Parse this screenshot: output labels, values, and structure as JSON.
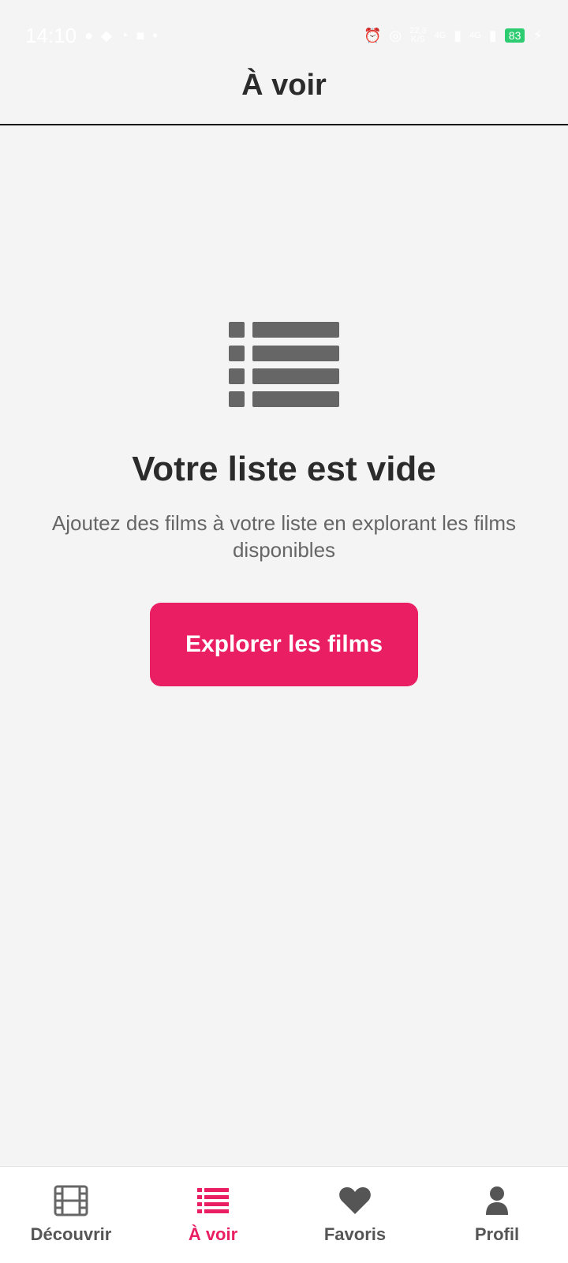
{
  "status_bar": {
    "time": "14:10",
    "network_speed": "22,3",
    "network_speed_unit": "K/S",
    "signal_1": "4G",
    "signal_2": "4G",
    "battery": "83",
    "icons": [
      "messenger-icon",
      "snapchat-icon",
      "sync-icon",
      "app-icon",
      "dot-icon",
      "alarm-icon",
      "hotspot-icon",
      "charging-icon"
    ]
  },
  "header": {
    "title": "À voir"
  },
  "empty_state": {
    "icon": "list-icon",
    "title": "Votre liste est vide",
    "description": "Ajoutez des films à votre liste en explorant les films disponibles",
    "button_label": "Explorer les films"
  },
  "bottom_nav": {
    "items": [
      {
        "label": "Découvrir",
        "icon": "film-icon"
      },
      {
        "label": "À voir",
        "icon": "list-icon",
        "active": true
      },
      {
        "label": "Favoris",
        "icon": "heart-icon"
      },
      {
        "label": "Profil",
        "icon": "person-icon"
      }
    ]
  },
  "colors": {
    "accent": "#e91e63",
    "background": "#f4f4f4",
    "icon_gray": "#666666"
  }
}
